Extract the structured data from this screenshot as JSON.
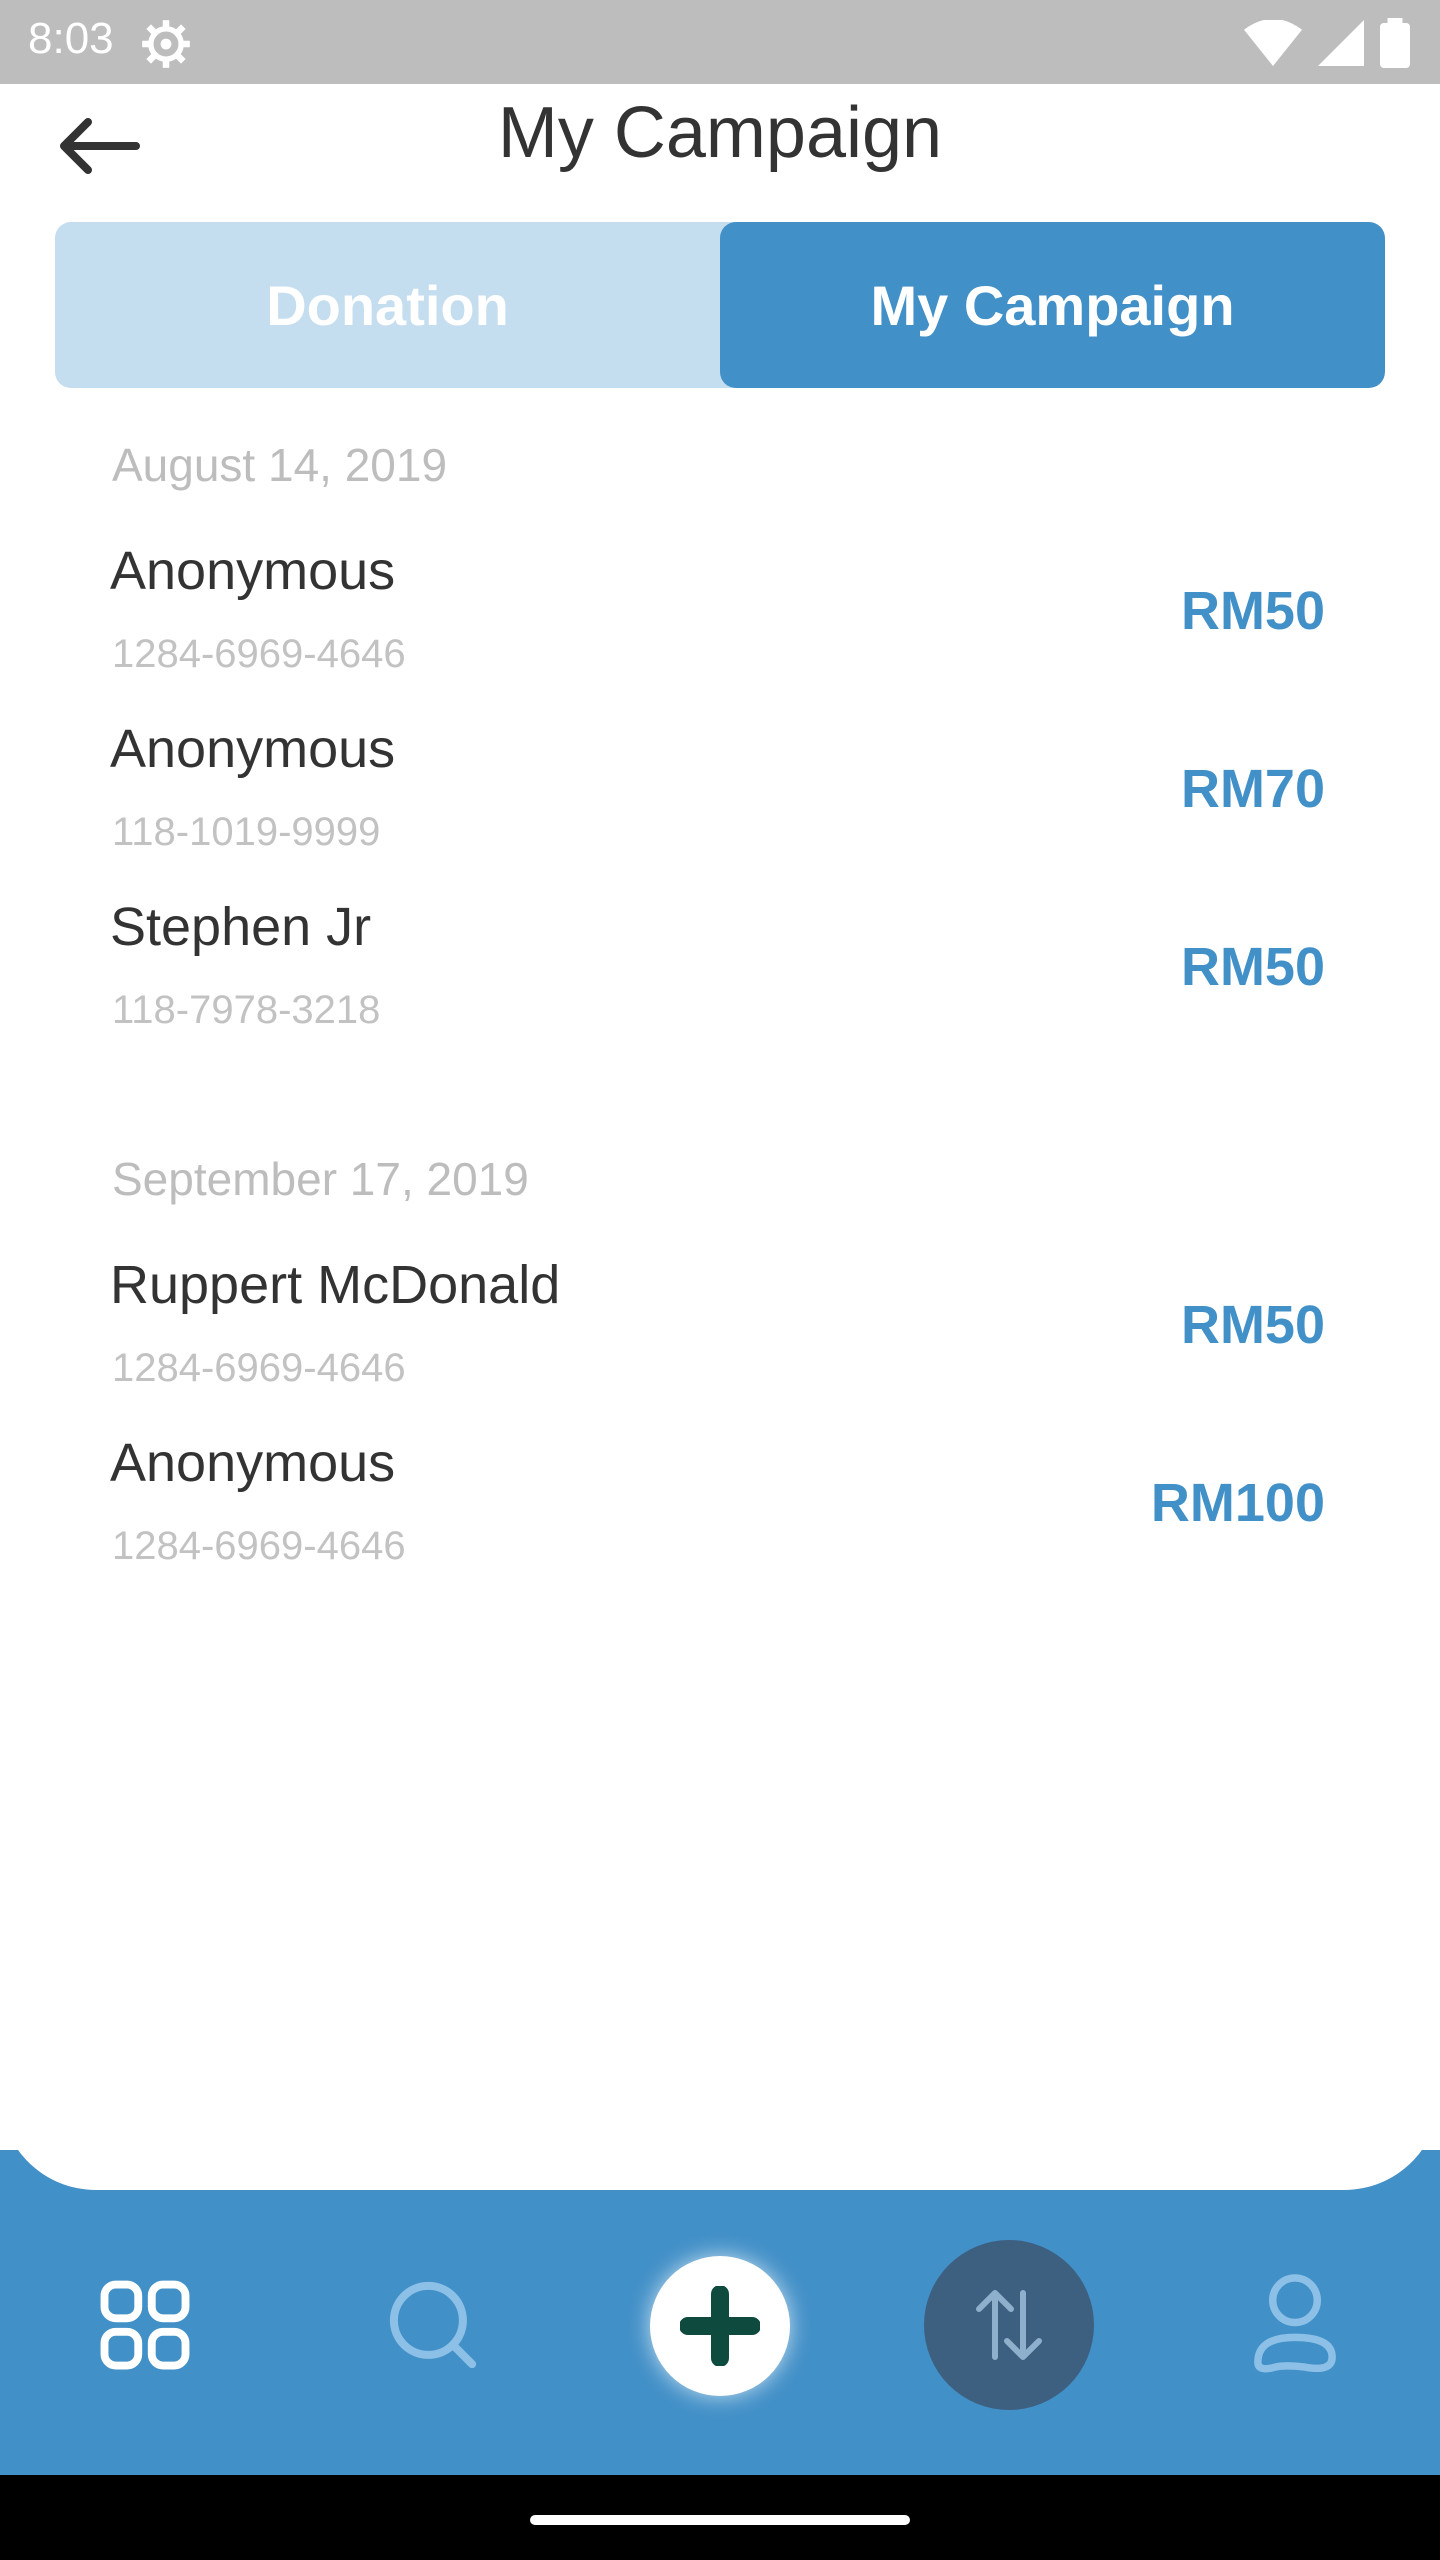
{
  "status_bar": {
    "time": "8:03"
  },
  "header": {
    "title": "My Campaign"
  },
  "tabs": [
    {
      "label": "Donation",
      "active": false
    },
    {
      "label": "My Campaign",
      "active": true
    }
  ],
  "groups": [
    {
      "date": "August 14, 2019",
      "entries": [
        {
          "name": "Anonymous",
          "ref": "1284-6969-4646",
          "amount": "RM50"
        },
        {
          "name": "Anonymous",
          "ref": "118-1019-9999",
          "amount": "RM70"
        },
        {
          "name": "Stephen Jr",
          "ref": "118-7978-3218",
          "amount": "RM50"
        }
      ]
    },
    {
      "date": "September 17, 2019",
      "entries": [
        {
          "name": "Ruppert McDonald",
          "ref": "1284-6969-4646",
          "amount": "RM50"
        },
        {
          "name": "Anonymous",
          "ref": "1284-6969-4646",
          "amount": "RM100"
        }
      ]
    }
  ],
  "bottom_nav": {
    "items": [
      "grid-icon",
      "search-icon",
      "add-icon",
      "transfer-icon",
      "profile-icon"
    ],
    "active": "transfer-icon"
  },
  "colors": {
    "accent": "#4290c8",
    "accent_light": "#c4ddef",
    "active_nav": "#3d5f80",
    "plus_icon": "#0f4a3f"
  }
}
